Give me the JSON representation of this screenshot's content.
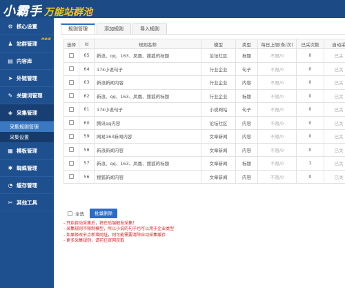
{
  "app": {
    "logo_main": "小霸手",
    "logo_sub": "万能站群池"
  },
  "sidebar": {
    "items": [
      {
        "icon": "gear-icon",
        "glyph": "⚙",
        "label": "核心设置"
      },
      {
        "icon": "user-icon",
        "glyph": "♟",
        "label": "站群管理",
        "badge": "new"
      },
      {
        "icon": "document-icon",
        "glyph": "▤",
        "label": "内容库"
      },
      {
        "icon": "link-icon",
        "glyph": "➤",
        "label": "外链管理"
      },
      {
        "icon": "keyword-icon",
        "glyph": "✎",
        "label": "关键词管理"
      },
      {
        "icon": "collect-icon",
        "glyph": "◈",
        "label": "采集管理"
      }
    ],
    "subitems": [
      {
        "label": "采集规则管理",
        "active": true
      },
      {
        "label": "采集设置",
        "active": false
      }
    ],
    "items2": [
      {
        "icon": "template-icon",
        "glyph": "▦",
        "label": "模板管理"
      },
      {
        "icon": "spider-icon",
        "glyph": "✱",
        "label": "蜘蛛管理"
      },
      {
        "icon": "cache-icon",
        "glyph": "◔",
        "label": "缓存管理"
      },
      {
        "icon": "tools-icon",
        "glyph": "✂",
        "label": "其他工具"
      }
    ]
  },
  "tabs": [
    {
      "label": "规则管理",
      "active": true
    },
    {
      "label": "添加规则",
      "active": false
    },
    {
      "label": "导入规则",
      "active": false
    }
  ],
  "table": {
    "headers": [
      "选择",
      "id",
      "规则名称",
      "模型",
      "类型",
      "每日上限(条/次)",
      "已采次数",
      "自动采"
    ],
    "rows": [
      {
        "id": "65",
        "name": "新浪、qq、163、凤凰、搜狐的标题",
        "model": "论坛社区",
        "type": "标题",
        "limit": "不限/0",
        "count": "0",
        "auto": "已关"
      },
      {
        "id": "64",
        "name": "17k小说句子",
        "model": "行业企业",
        "type": "句子",
        "limit": "不限/0",
        "count": "0",
        "auto": "已关"
      },
      {
        "id": "63",
        "name": "新浪新闻内容",
        "model": "行业企业",
        "type": "内容",
        "limit": "不限/0",
        "count": "0",
        "auto": "已关"
      },
      {
        "id": "62",
        "name": "新浪、qq、163、凤凰、搜狐的标题",
        "model": "行业企业",
        "type": "标题",
        "limit": "不限/0",
        "count": "0",
        "auto": "已关"
      },
      {
        "id": "61",
        "name": "17k小说句子",
        "model": "小说网站",
        "type": "句子",
        "limit": "不限/0",
        "count": "0",
        "auto": "已关"
      },
      {
        "id": "60",
        "name": "腾讯qq内容",
        "model": "论坛社区",
        "type": "内容",
        "limit": "不限/0",
        "count": "0",
        "auto": "已关"
      },
      {
        "id": "59",
        "name": "网易163新闻内容",
        "model": "文章新闻",
        "type": "内容",
        "limit": "不限/0",
        "count": "0",
        "auto": "已关"
      },
      {
        "id": "58",
        "name": "新浪新闻内容",
        "model": "文章新闻",
        "type": "内容",
        "limit": "不限/0",
        "count": "0",
        "auto": "已关"
      },
      {
        "id": "57",
        "name": "新浪、qq、163、凤凰、搜狐的标题",
        "model": "文章新闻",
        "type": "标题",
        "limit": "不限/0",
        "count": "1",
        "auto": "已关"
      },
      {
        "id": "56",
        "name": "搜狐新闻内容",
        "model": "文章新闻",
        "type": "内容",
        "limit": "不限/0",
        "count": "0",
        "auto": "已关"
      }
    ]
  },
  "footer": {
    "select_all": "全选",
    "batch_delete": "批量删除"
  },
  "tips": [
    "- 开启自动采集后，将在后端触发采集！",
    "- 采集规则不限制模型，所以小说的句子也可以用于企业类型",
    "- 如果修改节点新增网址，则可能需要清除自动采集缓存",
    "- 更多采集规则，请前往官网获取"
  ],
  "colors": {
    "banner": "#1b4a85",
    "sidebar": "#1e4f8e",
    "accent": "#2a6cc7",
    "tip_text": "#dd2222",
    "logo_sub": "#f5c518"
  }
}
